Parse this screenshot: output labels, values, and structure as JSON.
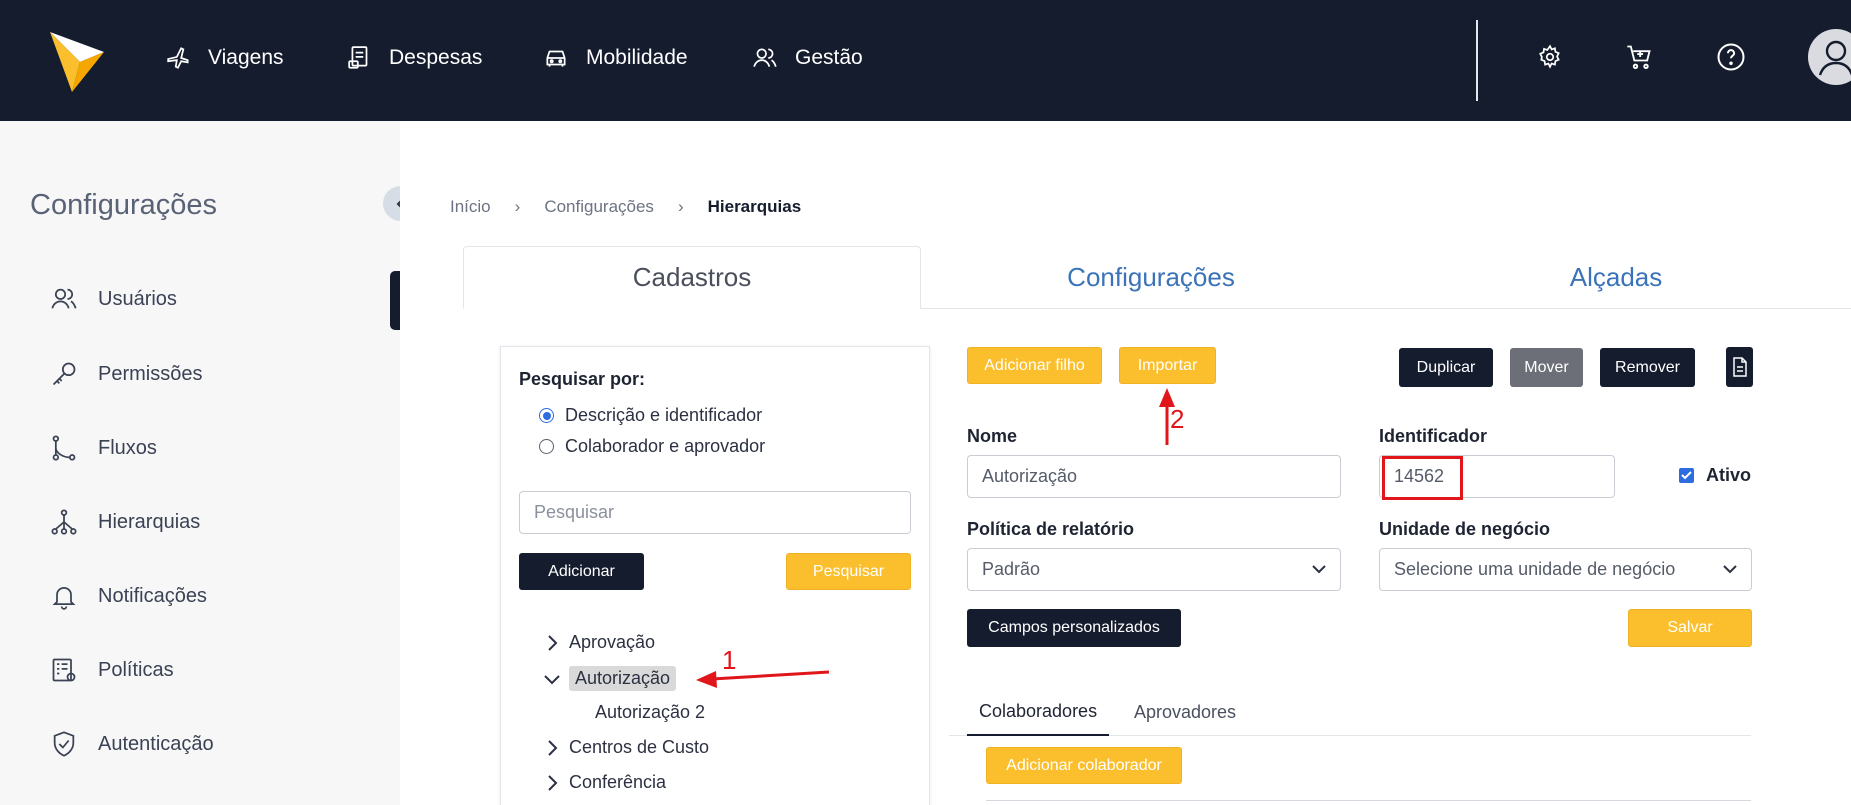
{
  "topnav": {
    "items": [
      {
        "label": "Viagens",
        "icon": "airplane-icon"
      },
      {
        "label": "Despesas",
        "icon": "receipt-icon"
      },
      {
        "label": "Mobilidade",
        "icon": "car-icon"
      },
      {
        "label": "Gestão",
        "icon": "users-icon"
      }
    ],
    "right_icons": [
      "gear-icon",
      "cart-add-icon",
      "help-icon",
      "user-icon"
    ]
  },
  "sidebar": {
    "title": "Configurações",
    "items": [
      {
        "label": "Usuários",
        "icon": "users-icon"
      },
      {
        "label": "Permissões",
        "icon": "key-icon"
      },
      {
        "label": "Fluxos",
        "icon": "flow-icon"
      },
      {
        "label": "Hierarquias",
        "icon": "hierarchy-icon"
      },
      {
        "label": "Notificações",
        "icon": "bell-icon"
      },
      {
        "label": "Políticas",
        "icon": "policy-icon"
      },
      {
        "label": "Autenticação",
        "icon": "shield-icon"
      }
    ]
  },
  "breadcrumb": [
    "Início",
    "Configurações",
    "Hierarquias"
  ],
  "tabs": [
    "Cadastros",
    "Configurações",
    "Alçadas"
  ],
  "search_panel": {
    "label": "Pesquisar por:",
    "options": [
      "Descrição e identificador",
      "Colaborador e aprovador"
    ],
    "selected_option": "Descrição e identificador",
    "placeholder": "Pesquisar",
    "add_label": "Adicionar",
    "search_label": "Pesquisar"
  },
  "tree": [
    {
      "label": "Aprovação",
      "expanded": false
    },
    {
      "label": "Autorização",
      "expanded": true,
      "selected": true
    },
    {
      "label": "Autorização 2",
      "child": true
    },
    {
      "label": "Centros de Custo",
      "expanded": false
    },
    {
      "label": "Conferência",
      "expanded": false
    }
  ],
  "actions": {
    "add_child": "Adicionar filho",
    "import": "Importar",
    "duplicate": "Duplicar",
    "move": "Mover",
    "remove": "Remover"
  },
  "form": {
    "name_label": "Nome",
    "name_value": "Autorização",
    "id_label": "Identificador",
    "id_value": "14562",
    "active_label": "Ativo",
    "policy_label": "Política de relatório",
    "policy_value": "Padrão",
    "unit_label": "Unidade de negócio",
    "unit_value": "Selecione uma unidade de negócio",
    "custom_fields": "Campos personalizados",
    "save": "Salvar"
  },
  "subtabs": [
    "Colaboradores",
    "Aprovadores"
  ],
  "add_collaborator": "Adicionar colaborador",
  "annotations": {
    "n1": "1",
    "n2": "2"
  },
  "colors": {
    "navbar": "#141c2e",
    "accent": "#fbbf2d",
    "link": "#3b73b9",
    "annotation": "#e0161b"
  }
}
